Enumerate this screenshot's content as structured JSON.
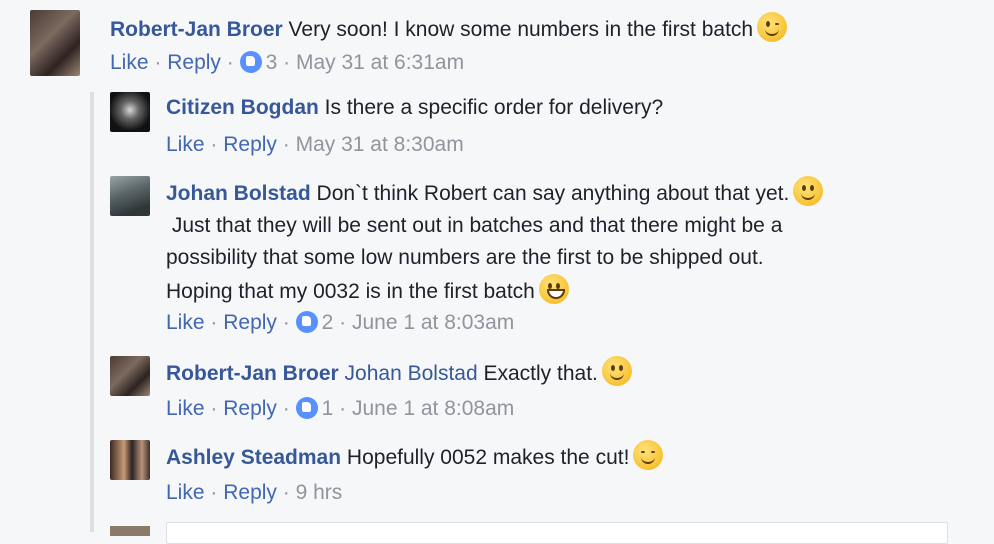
{
  "comments": [
    {
      "author": "Robert-Jan Broer",
      "text": "Very soon! I know some numbers in the first batch",
      "like_label": "Like",
      "reply_label": "Reply",
      "like_count": "3",
      "timestamp": "May 31 at 6:31am"
    },
    {
      "author": "Citizen Bogdan",
      "text": "Is there a specific order for delivery?",
      "like_label": "Like",
      "reply_label": "Reply",
      "timestamp": "May 31 at 8:30am"
    },
    {
      "author": "Johan Bolstad",
      "lines": [
        "Don`t think Robert can say anything about that yet.",
        " Just that they will be sent out in batches and that there might be a",
        "possibility that some low numbers are the first to be shipped out.",
        "Hoping that my 0032 is in the first batch"
      ],
      "like_label": "Like",
      "reply_label": "Reply",
      "like_count": "2",
      "timestamp": "June 1 at 8:03am"
    },
    {
      "author": "Robert-Jan Broer",
      "tag": "Johan Bolstad",
      "text": "Exactly that.",
      "like_label": "Like",
      "reply_label": "Reply",
      "like_count": "1",
      "timestamp": "June 1 at 8:08am"
    },
    {
      "author": "Ashley Steadman",
      "text": "Hopefully 0052 makes the cut!",
      "like_label": "Like",
      "reply_label": "Reply",
      "timestamp": "9 hrs"
    }
  ],
  "separator": "·",
  "colors": {
    "name": "#365899",
    "meta": "#90949c",
    "link": "#4267b2",
    "like_badge": "#5890ff"
  }
}
